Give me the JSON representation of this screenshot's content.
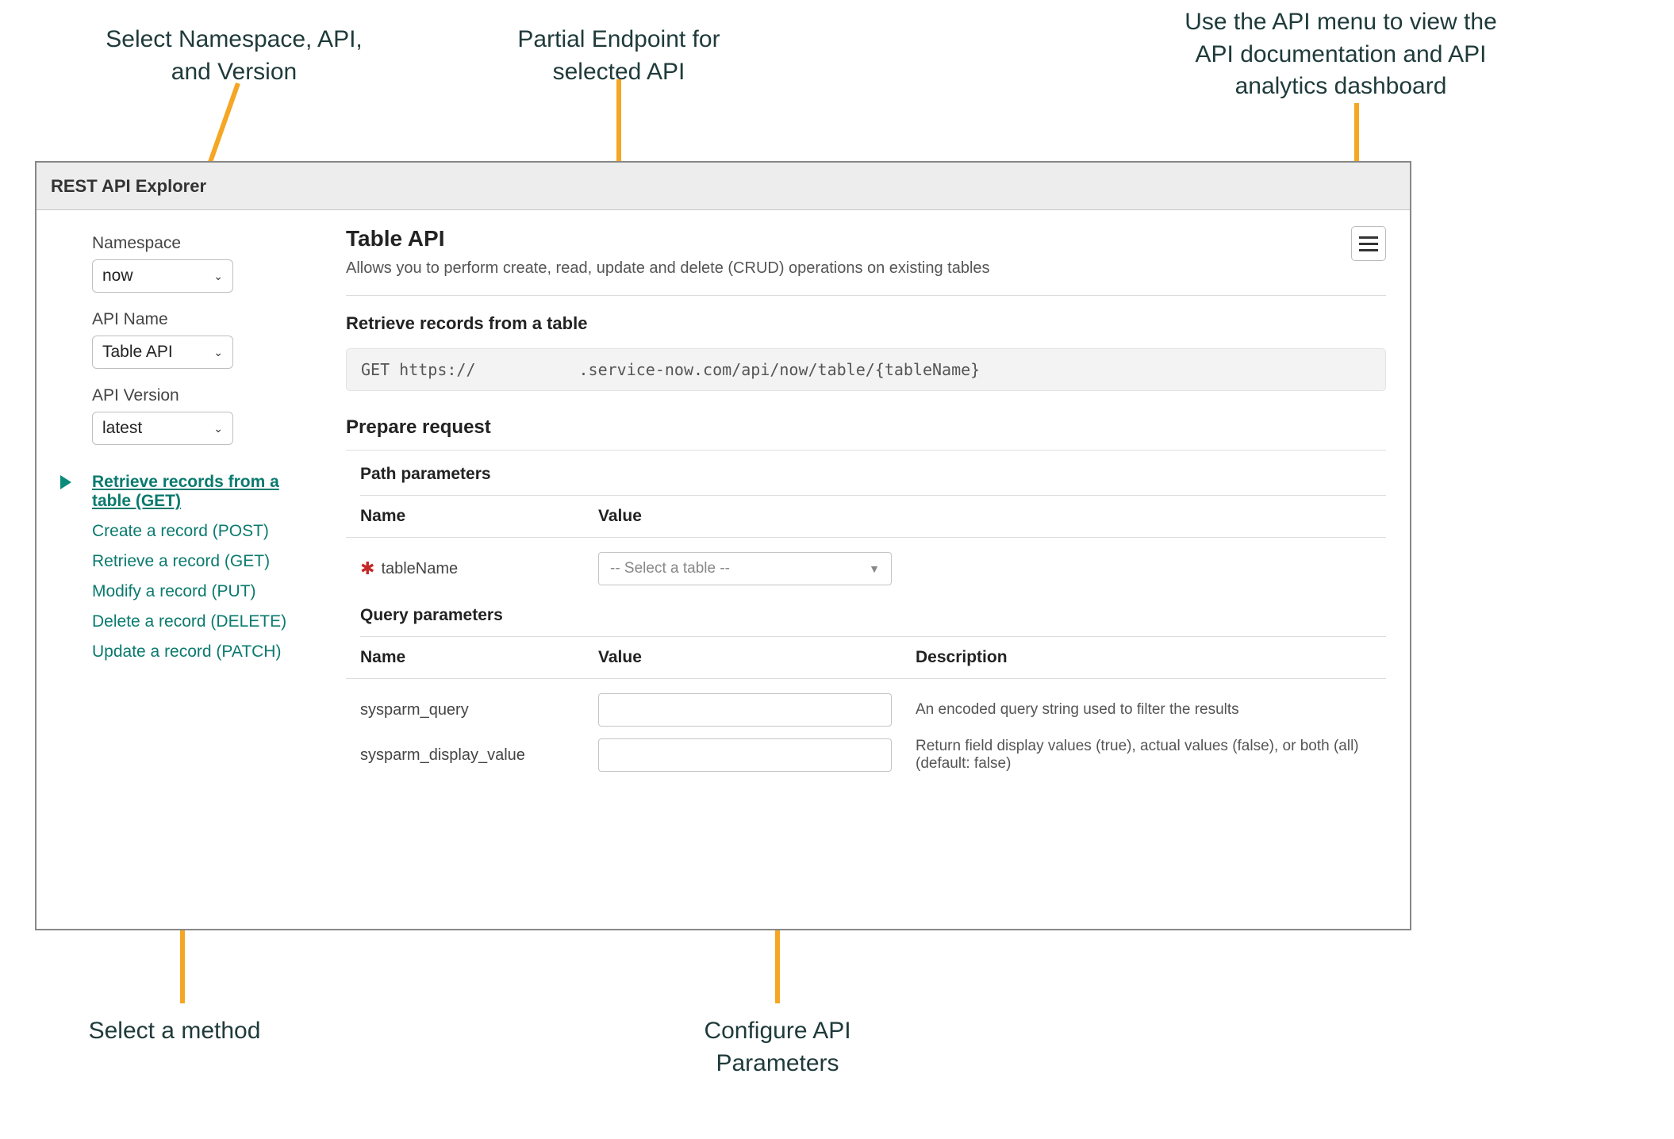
{
  "annotations": {
    "ns_api_version": "Select Namespace, API,\nand Version",
    "partial_endpoint": "Partial Endpoint for\nselected API",
    "api_menu": "Use the API menu to view the\nAPI documentation and API\nanalytics dashboard",
    "select_method": "Select a method",
    "configure_params": "Configure API\nParameters"
  },
  "explorer": {
    "title": "REST API Explorer",
    "sidebar": {
      "namespace_label": "Namespace",
      "namespace_value": "now",
      "api_name_label": "API Name",
      "api_name_value": "Table API",
      "api_version_label": "API Version",
      "api_version_value": "latest",
      "methods": [
        {
          "label": "Retrieve records from a table  (GET)",
          "active": true
        },
        {
          "label": "Create a record  (POST)",
          "active": false
        },
        {
          "label": "Retrieve a record  (GET)",
          "active": false
        },
        {
          "label": "Modify a record  (PUT)",
          "active": false
        },
        {
          "label": "Delete a record  (DELETE)",
          "active": false
        },
        {
          "label": "Update a record  (PATCH)",
          "active": false
        }
      ]
    },
    "main": {
      "api_title": "Table API",
      "api_desc": "Allows you to perform create, read, update and delete (CRUD) operations on existing tables",
      "retrieve_title": "Retrieve records from a table",
      "endpoint_prefix": "GET https://",
      "endpoint_suffix": ".service-now.com/api/now/table/{tableName}",
      "prepare_title": "Prepare request",
      "path_params": {
        "heading": "Path parameters",
        "name_col": "Name",
        "value_col": "Value",
        "rows": [
          {
            "name": "tableName",
            "required": true,
            "value_placeholder": "-- Select a table --"
          }
        ]
      },
      "query_params": {
        "heading": "Query parameters",
        "name_col": "Name",
        "value_col": "Value",
        "desc_col": "Description",
        "rows": [
          {
            "name": "sysparm_query",
            "desc": "An encoded query string used to filter the results"
          },
          {
            "name": "sysparm_display_value",
            "desc": "Return field display values (true), actual values (false), or both (all) (default: false)"
          }
        ]
      }
    }
  }
}
